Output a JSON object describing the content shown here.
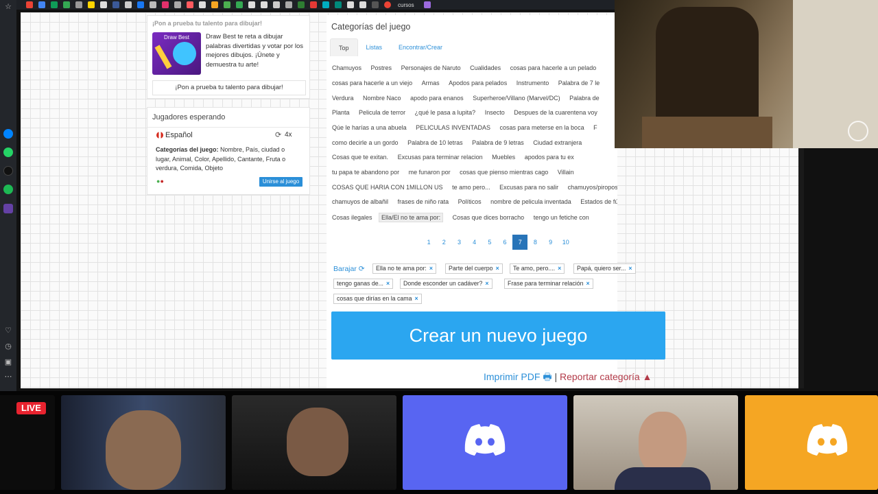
{
  "topbar": {
    "tab_label": "cursos"
  },
  "promo": {
    "heading": "¡Pon a prueba tu talento para dibujar!",
    "image_title": "Draw Best",
    "text": "Draw Best te reta a dibujar palabras divertidas y votar por los mejores dibujos. ¡Únete y demuestra tu arte!",
    "button": "¡Pon a prueba tu talento para dibujar!"
  },
  "waiting": {
    "title": "Jugadores esperando",
    "language": "Español",
    "rounds": "4x",
    "categories_label": "Categorías del juego:",
    "categories_value": " Nombre, País, ciudad o lugar, Animal, Color, Apellido, Cantante, Fruta o verdura, Comida, Objeto",
    "join_button": "Unirse al juego"
  },
  "main": {
    "title": "Categorías del juego",
    "tabs": [
      "Top",
      "Listas",
      "Encontrar/Crear"
    ],
    "category_rows": [
      [
        "Chamuyos",
        "Postres",
        "Personajes de Naruto",
        "Cualidades",
        "cosas para hacerle a un pelado"
      ],
      [
        "cosas para hacerle a un viejo",
        "Armas",
        "Apodos para pelados",
        "Instrumento",
        "Palabra de 7 le"
      ],
      [
        "Verdura",
        "Nombre Naco",
        "apodo para enanos",
        "Superheroe/Villano (Marvel/DC)",
        "Palabra de"
      ],
      [
        "Planta",
        "Pelicula de terror",
        "¿qué le pasa a lupita?",
        "Insecto",
        "Despues de la cuarentena voy"
      ],
      [
        "Qúe le harías a una abuela",
        "PELICULAS INVENTADAS",
        "cosas para meterse en la boca",
        "F"
      ],
      [
        "como decirle a un gordo",
        "Palabra de 10 letras",
        "Palabra de 9 letras",
        "Ciudad extranjera"
      ],
      [
        "Cosas que te exitan.",
        "Excusas para terminar relacion",
        "Muebles",
        "apodos para tu ex"
      ],
      [
        "tu papa te abandono por",
        "me funaron por",
        "cosas que pienso mientras cago",
        "Villain"
      ],
      [
        "COSAS QUE HARIA CON 1MILLON US",
        "te amo pero...",
        "Excusas para no salir",
        "chamuyos/piropos..."
      ],
      [
        "chamuyos de albañil",
        "frases de niño rata",
        "Políticos",
        "nombre de pelicula inventada",
        "Estados de fútbol"
      ],
      [
        "Cosas ilegales",
        "Ella/El no te ama por:",
        "Cosas que dices borracho",
        "tengo un fetiche con"
      ]
    ],
    "pages": [
      "1",
      "2",
      "3",
      "4",
      "5",
      "6",
      "7",
      "8",
      "9",
      "10"
    ],
    "active_page": "7",
    "shuffle_label": "Barajar",
    "selected": [
      "Ella no te ama por:",
      "Parte del cuerpo",
      "Te amo, pero....",
      "Papá, quiero ser...",
      "tengo ganas de...",
      "Donde esconder un cadáver?",
      "Frase para terminar relación",
      "cosas que dirías en la cama"
    ],
    "create_button": "Crear un nuevo juego",
    "print_pdf": "Imprimir PDF",
    "separator": " | ",
    "report": "Reportar categoría"
  },
  "stream": {
    "live_badge": "LIVE",
    "tiles": [
      "camera",
      "camera",
      "discord",
      "camera",
      "discord"
    ],
    "colors": {
      "discord_purple": "#5865f2",
      "discord_yellow": "#f5a623",
      "accent_blue": "#2ba6f0",
      "live_red": "#e8232f"
    }
  }
}
